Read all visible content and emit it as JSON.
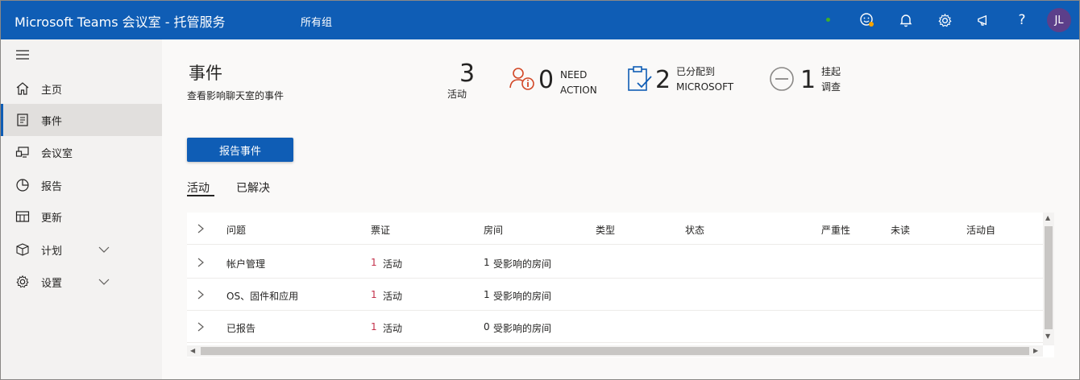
{
  "header": {
    "app_title": "Microsoft Teams 会议室 - 托管服务",
    "group_label": "所有组",
    "avatar_initials": "JL",
    "icons": [
      "emoji-icon",
      "bell-icon",
      "gear-icon",
      "megaphone-icon",
      "help-icon"
    ]
  },
  "sidebar": {
    "items": [
      {
        "label": "主页",
        "icon": "home-icon"
      },
      {
        "label": "事件",
        "icon": "incident-icon",
        "active": true
      },
      {
        "label": "会议室",
        "icon": "room-icon"
      },
      {
        "label": "报告",
        "icon": "pie-chart-icon"
      },
      {
        "label": "更新",
        "icon": "update-icon"
      },
      {
        "label": "计划",
        "icon": "plan-icon",
        "expandable": true
      },
      {
        "label": "设置",
        "icon": "settings-icon",
        "expandable": true
      }
    ]
  },
  "page": {
    "title": "事件",
    "subtitle": "查看影响聊天室的事件"
  },
  "stats": {
    "active": {
      "value": "3",
      "label": "活动"
    },
    "need_action": {
      "value": "0",
      "label_line1": "NEED",
      "label_line2": "ACTION"
    },
    "assigned": {
      "value": "2",
      "label_line1": "已分配到",
      "label_line2": "MICROSOFT"
    },
    "pending": {
      "value": "1",
      "label_line1": "挂起",
      "label_line2": "调查"
    }
  },
  "actions": {
    "report_button": "报告事件"
  },
  "tabs": [
    {
      "label": "活动",
      "active": true
    },
    {
      "label": "已解决",
      "active": false
    }
  ],
  "table": {
    "columns": [
      "问题",
      "票证",
      "房间",
      "类型",
      "状态",
      "严重性",
      "未读",
      "活动自"
    ],
    "rows": [
      {
        "issue": "帐户管理",
        "ticket_count": "1",
        "ticket_label": "活动",
        "rooms_count": "1",
        "rooms_label": "受影响的房间"
      },
      {
        "issue": "OS、固件和应用",
        "ticket_count": "1",
        "ticket_label": "活动",
        "rooms_count": "1",
        "rooms_label": "受影响的房间"
      },
      {
        "issue": "已报告",
        "ticket_count": "1",
        "ticket_label": "活动",
        "rooms_count": "0",
        "rooms_label": "受影响的房间"
      }
    ]
  },
  "colors": {
    "brand": "#0f5db5",
    "stat_orange": "#d24726",
    "stat_blue": "#0f5db5",
    "number_red": "#c4314b",
    "presence_green": "#3fae29"
  }
}
